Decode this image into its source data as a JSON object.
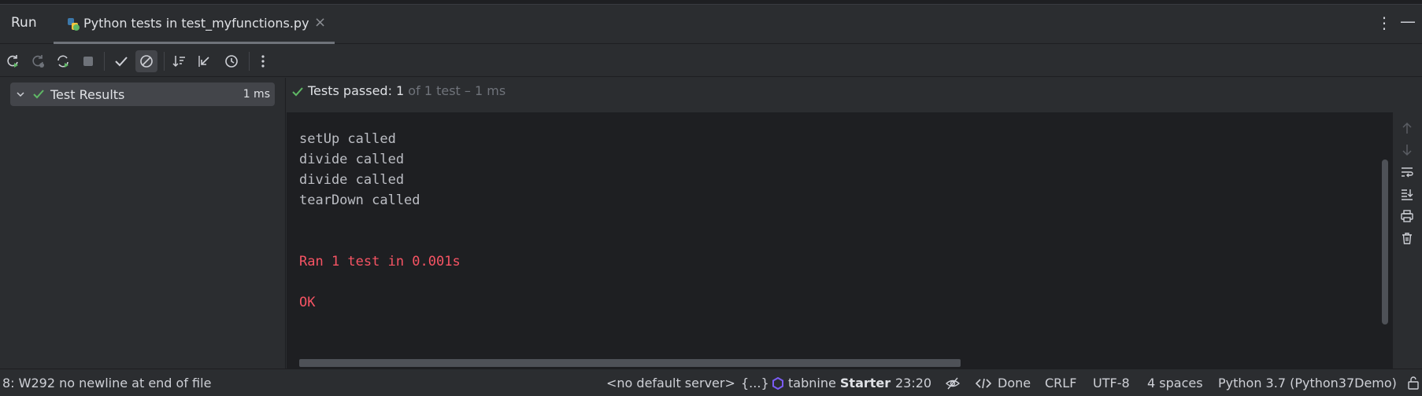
{
  "tabbar": {
    "run_label": "Run",
    "tab_label": "Python tests in test_myfunctions.py",
    "close_glyph": "×"
  },
  "toolbar": {
    "buttons": [
      "rerun-icon",
      "rerun-failed-icon",
      "toggle-auto-test-icon",
      "stop-icon",
      "show-passed-icon",
      "show-ignored-icon",
      "sort-icon",
      "collapse-icon",
      "history-icon",
      "more-options-icon"
    ]
  },
  "tree": {
    "root_label": "Test Results",
    "root_time": "1 ms"
  },
  "results_status": {
    "passed_label": "Tests passed: 1",
    "rest_label": " of 1 test – 1 ms"
  },
  "console": {
    "lines": [
      "setUp called",
      "divide called",
      "divide called",
      "tearDown called"
    ],
    "summary": "Ran 1 test in 0.001s",
    "result": "OK"
  },
  "statusbar": {
    "message": "8: W292 no newline at end of file",
    "server": "<no default server>",
    "braces": "{...}",
    "tabnine_name": "tabnine",
    "tabnine_plan": "Starter",
    "cursor": "23:20",
    "done": "Done",
    "line_sep": "CRLF",
    "encoding": "UTF-8",
    "indent": "4 spaces",
    "interpreter": "Python 3.7 (Python37Demo)"
  },
  "colors": {
    "background": "#2b2d30",
    "console_bg": "#1e1f22",
    "success_green": "#5fb865",
    "error_red": "#f75464",
    "tabnine_purple": "#7b5cf5"
  }
}
